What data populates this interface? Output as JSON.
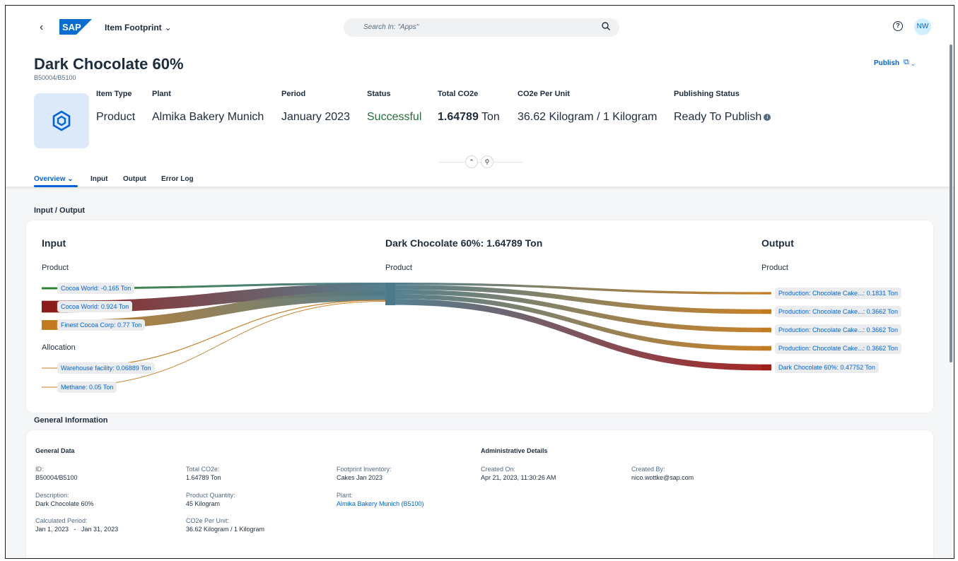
{
  "shell": {
    "back_glyph": "‹",
    "logo_text": "SAP",
    "app_title": "Item Footprint",
    "app_title_chevron": "⌄",
    "search_placeholder": "Search In: \"Apps\"",
    "search_icon": "search-icon",
    "help_glyph": "?",
    "avatar_initials": "NW"
  },
  "header": {
    "title": "Dark Chocolate 60%",
    "subtitle": "B50004/B5100",
    "publish_label": "Publish",
    "publish_menu_glyph": "⧉ ⌄",
    "attributes": [
      {
        "label": "Item Type",
        "value": "Product"
      },
      {
        "label": "Plant",
        "value": "Almika Bakery Munich"
      },
      {
        "label": "Period",
        "value": "January 2023"
      },
      {
        "label": "Status",
        "value": "Successful"
      },
      {
        "label": "Total CO2e",
        "value_bold": "1.64789",
        "value_unit": " Ton"
      },
      {
        "label": "CO2e Per Unit",
        "value": "36.62 Kilogram / 1 Kilogram"
      },
      {
        "label": "Publishing Status",
        "value": "Ready To Publish"
      }
    ],
    "info_glyph": "i",
    "collapse_glyph": "⌃",
    "pin_glyph": "⚲"
  },
  "tabs": [
    {
      "label": "Overview",
      "chevron": "⌄"
    },
    {
      "label": "Input"
    },
    {
      "label": "Output"
    },
    {
      "label": "Error Log"
    }
  ],
  "colors": {
    "accent": "#0064d9",
    "success": "#256f3a",
    "center_node": "#4d7a8a"
  },
  "io": {
    "section_title": "Input / Output",
    "input_heading": "Input",
    "center_heading": "Dark Chocolate 60%: 1.64789 Ton",
    "output_heading": "Output",
    "input_sub": "Product",
    "center_sub": "Product",
    "output_sub": "Product",
    "allocation_sub": "Allocation",
    "inputs": [
      {
        "label": "Cocoa World: -0.165 Ton",
        "value": -0.165,
        "color": "#2e7d32"
      },
      {
        "label": "Cocoa World: 0.924 Ton",
        "value": 0.924,
        "color": "#8b1a1a"
      },
      {
        "label": "Finest Cocoa Corp: 0.77 Ton",
        "value": 0.77,
        "color": "#c27a1f"
      }
    ],
    "allocations": [
      {
        "label": "Warehouse facility: 0.06889 Ton",
        "value": 0.06889,
        "color": "#c27a1f"
      },
      {
        "label": "Methane: 0.05 Ton",
        "value": 0.05,
        "color": "#c27a1f"
      }
    ],
    "outputs": [
      {
        "label": "Production: Chocolate Cake...: 0.1831 Ton",
        "value": 0.1831,
        "color": "#c27a1f"
      },
      {
        "label": "Production: Chocolate Cake...: 0.3662 Ton",
        "value": 0.3662,
        "color": "#c27a1f"
      },
      {
        "label": "Production: Chocolate Cake...: 0.3662 Ton",
        "value": 0.3662,
        "color": "#c27a1f"
      },
      {
        "label": "Production: Chocolate Cake...: 0.3662 Ton",
        "value": 0.3662,
        "color": "#c27a1f"
      },
      {
        "label": "Dark Chocolate 60%: 0.47752 Ton",
        "value": 0.47752,
        "color": "#a01c1c"
      }
    ]
  },
  "general": {
    "section_title": "General Information",
    "general_data_heading": "General Data",
    "admin_heading": "Administrative Details",
    "id_label": "ID:",
    "id_value": "B50004/B5100",
    "desc_label": "Description:",
    "desc_value": "Dark Chocolate 60%",
    "period_label": "Calculated Period:",
    "period_value": "Jan 1, 2023   -   Jan 31, 2023",
    "total_label": "Total CO2e:",
    "total_value": "1.64789 Ton",
    "qty_label": "Product Quantity:",
    "qty_value": "45 Kilogram",
    "perunit_label": "CO2e Per Unit:",
    "perunit_value": "36.62 Kilogram / 1 Kilogram",
    "inventory_label": "Footprint Inventory:",
    "inventory_value": "Cakes Jan 2023",
    "plant_label": "Plant:",
    "plant_value": "Almika Bakery Munich (B5100)",
    "created_on_label": "Created On:",
    "created_on_value": "Apr 21, 2023, 11:30:26 AM",
    "created_by_label": "Created By:",
    "created_by_value": "nico.wottke@sap.com"
  }
}
